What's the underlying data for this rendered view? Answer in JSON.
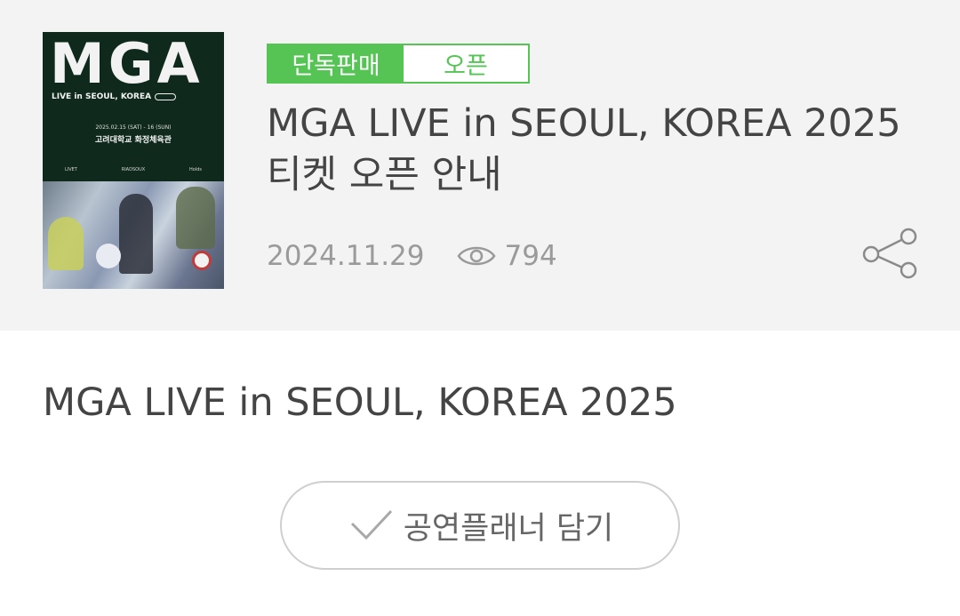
{
  "poster": {
    "logo": "MGA",
    "subtitle": "LIVE in SEOUL, KOREA",
    "date": "2025.02.15 (SAT) - 16 (SUN)",
    "venue": "고려대학교 화정체육관",
    "sponsors": [
      "LIVET",
      "RIADSOUX",
      "Holds"
    ]
  },
  "tags": {
    "exclusive": "단독판매",
    "open": "오픈"
  },
  "article": {
    "title": "MGA LIVE in SEOUL, KOREA 2025 티켓 오픈 안내",
    "date": "2024.11.29",
    "views": "794"
  },
  "body": {
    "title": "MGA LIVE in SEOUL, KOREA 2025"
  },
  "planner_button": {
    "label": "공연플래너 담기"
  },
  "icons": {
    "views": "eye-icon",
    "share": "share-icon",
    "check": "check-icon"
  },
  "colors": {
    "accent": "#55c455",
    "header_bg": "#f3f3f3",
    "text": "#444444",
    "meta": "#9a9a9a"
  }
}
